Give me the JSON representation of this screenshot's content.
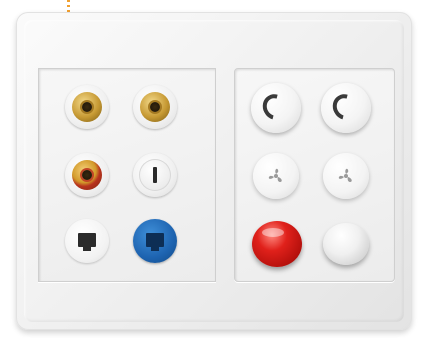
{
  "colors": {
    "plate": "#f1f1f1",
    "gold": "#c79a34",
    "rca_red": "#b8321e",
    "lan_blue": "#1d63b0",
    "button_red": "#e0211b"
  },
  "left_module": {
    "sockets": [
      {
        "kind": "rca-gold",
        "icon": "rca-gold-icon"
      },
      {
        "kind": "rca-gold",
        "icon": "rca-gold-icon"
      },
      {
        "kind": "rca-red",
        "icon": "rca-red-icon"
      },
      {
        "kind": "coax",
        "icon": "coax-icon"
      },
      {
        "kind": "rj45-white",
        "icon": "ethernet-port-icon"
      },
      {
        "kind": "rj45-blue",
        "icon": "ethernet-port-icon"
      }
    ]
  },
  "right_module": {
    "controls": [
      {
        "kind": "dimmer-dial",
        "icon": "dial-arc-icon"
      },
      {
        "kind": "dimmer-dial",
        "icon": "dial-arc-icon"
      },
      {
        "kind": "fan-button",
        "icon": "fan-icon"
      },
      {
        "kind": "fan-button",
        "icon": "fan-icon"
      },
      {
        "kind": "push-button-red",
        "icon": "red-button-icon"
      },
      {
        "kind": "push-button-white",
        "icon": "white-button-icon"
      }
    ]
  }
}
